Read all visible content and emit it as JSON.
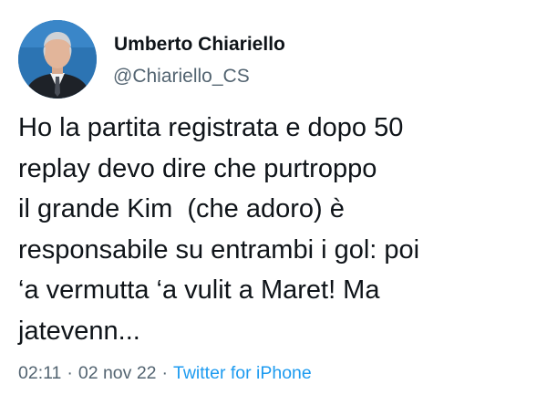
{
  "author": {
    "name": "Umberto Chiariello",
    "handle": "@Chiariello_CS",
    "avatar_icon": "profile-photo"
  },
  "tweet": {
    "lines": [
      "Ho la partita registrata e dopo 50",
      "replay devo dire che purtroppo",
      "il grande Kim  (che adoro) è",
      "responsabile su entrambi i gol: poi",
      "‘a vermutta ‘a vulit a Maret! Ma",
      "jatevenn..."
    ]
  },
  "meta": {
    "time": "02:11",
    "separator": "·",
    "date": "02 nov 22",
    "source": "Twitter for iPhone"
  },
  "colors": {
    "text": "#0f1419",
    "secondary": "#536471",
    "link": "#1d9bf0"
  }
}
